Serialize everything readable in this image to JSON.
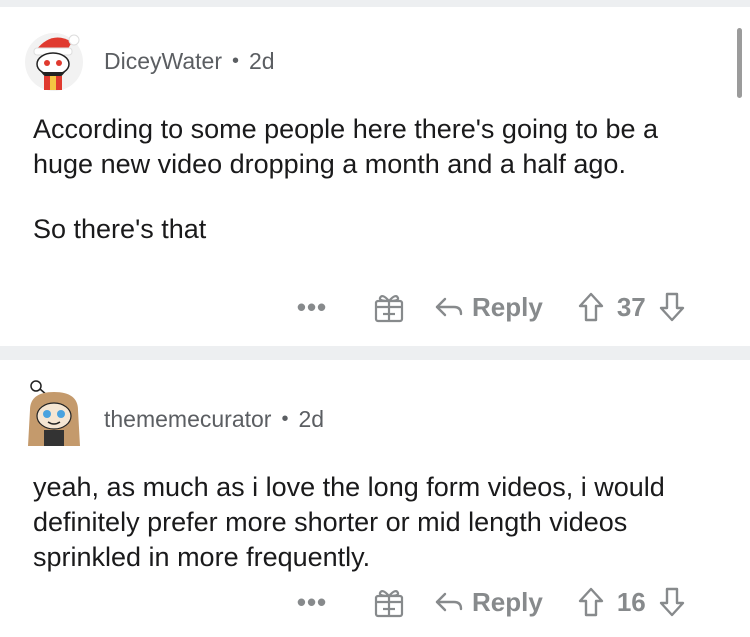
{
  "comments": [
    {
      "author": "DiceyWater",
      "separator": "•",
      "age": "2d",
      "paragraphs": [
        "According to some people here there's going to be a huge new video dropping a month and a half ago.",
        "So there's that"
      ],
      "more_label": "•••",
      "reply_label": "Reply",
      "score": "37",
      "avatar_icon": "santa-snoo-icon"
    },
    {
      "author": "thememecurator",
      "separator": "•",
      "age": "2d",
      "paragraphs": [
        "yeah, as much as i love the long form videos, i would definitely prefer more shorter or mid length videos sprinkled in more frequently."
      ],
      "more_label": "•••",
      "reply_label": "Reply",
      "score": "16",
      "avatar_icon": "long-hair-snoo-icon"
    }
  ],
  "colors": {
    "meta_gray": "#878a8c",
    "text": "#1a1a1b",
    "band": "#edeff1"
  }
}
